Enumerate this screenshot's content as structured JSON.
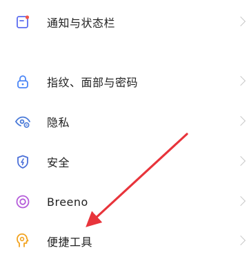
{
  "settings": {
    "items": [
      {
        "label": "通知与状态栏",
        "icon": "notification-statusbar-icon",
        "color": "#5b6cf0"
      },
      {
        "label": "指纹、面部与密码",
        "icon": "lock-icon",
        "color": "#4b86f7"
      },
      {
        "label": "隐私",
        "icon": "privacy-eye-icon",
        "color": "#4a7ad8"
      },
      {
        "label": "安全",
        "icon": "shield-icon",
        "color": "#4a6fd8"
      },
      {
        "label": "Breeno",
        "icon": "breeno-icon",
        "color": "#b45bd9"
      },
      {
        "label": "便捷工具",
        "icon": "convenience-tools-icon",
        "color": "#f2a21d"
      }
    ]
  },
  "annotation": {
    "arrow_color": "#e8343b"
  }
}
